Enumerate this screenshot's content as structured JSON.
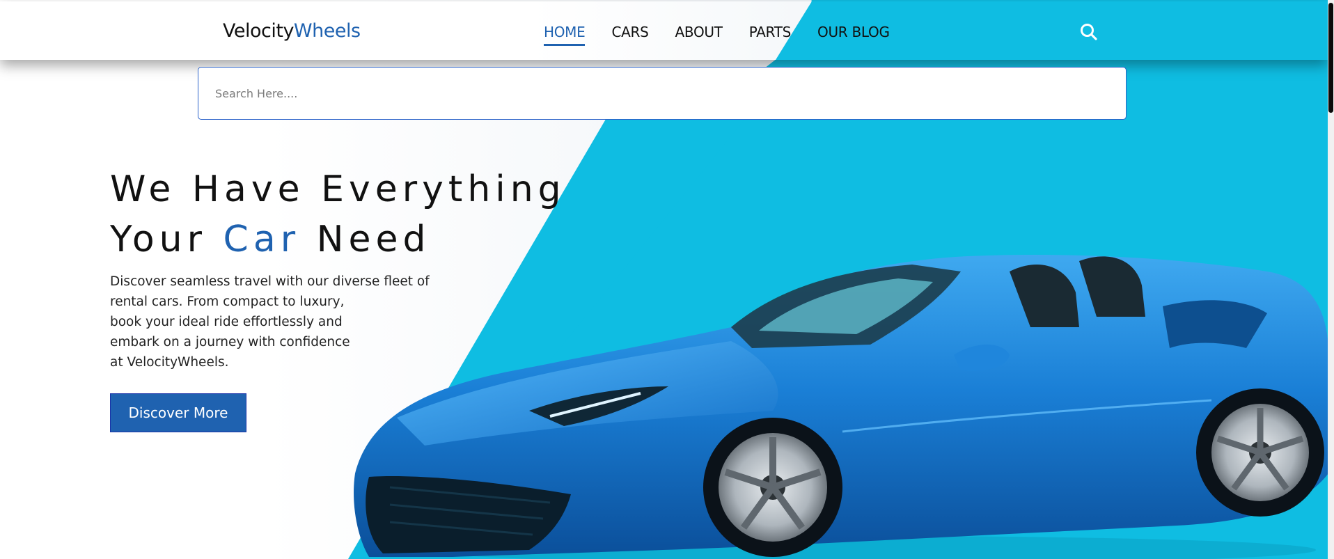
{
  "brand": {
    "part1": "Velocity",
    "part2": "Wheels"
  },
  "nav": {
    "items": [
      {
        "label": "HOME"
      },
      {
        "label": "CARS"
      },
      {
        "label": "ABOUT"
      },
      {
        "label": "PARTS"
      },
      {
        "label": "OUR BLOG"
      }
    ],
    "active": "HOME"
  },
  "search": {
    "placeholder": "Search Here....",
    "icon": "search-icon"
  },
  "hero": {
    "title_line1": "We Have Everything",
    "title_line2_pre": "Your ",
    "title_line2_accent": "Car",
    "title_line2_post": " Need",
    "description_lines": [
      "Discover seamless travel with our diverse fleet of",
      "rental cars. From compact to luxury,",
      "book your ideal ride effortlessly and",
      "embark on a journey with confidence",
      "at VelocityWheels."
    ],
    "cta_label": "Discover More"
  },
  "colors": {
    "accent": "#1f62b0",
    "cyan": "#0fbde2",
    "car_blue": "#1a7fd6"
  }
}
